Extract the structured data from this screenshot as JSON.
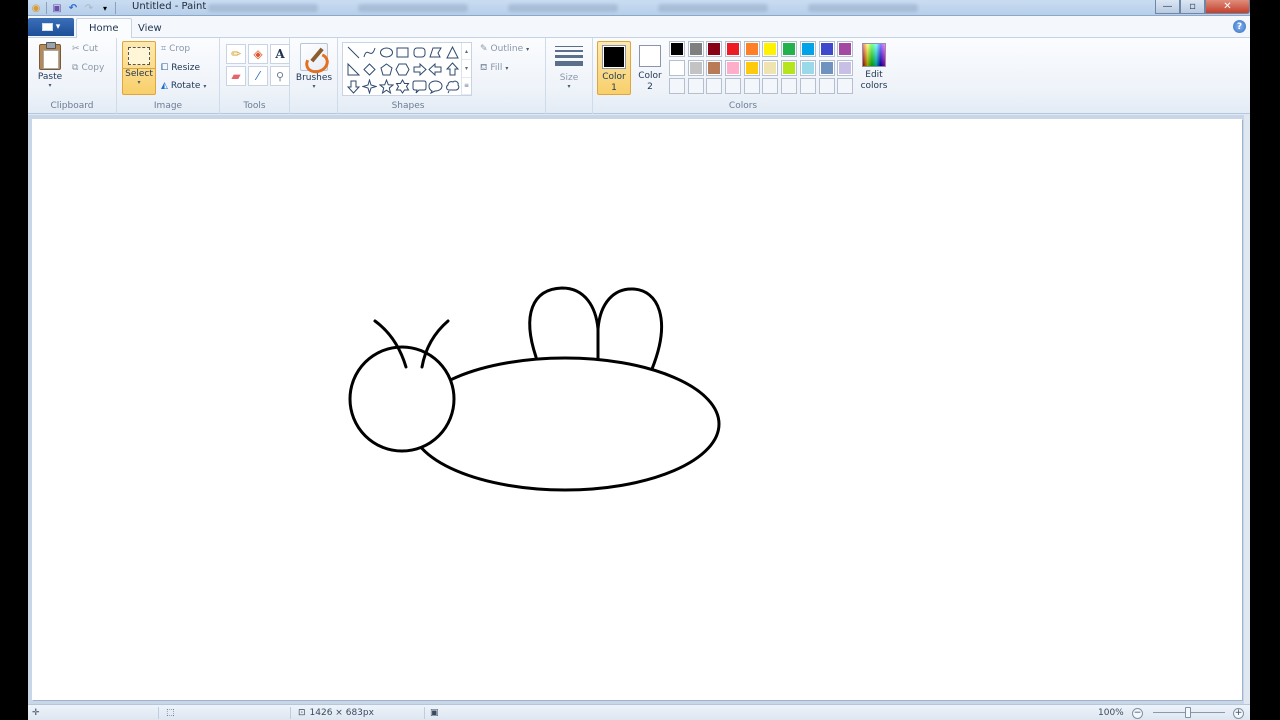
{
  "window": {
    "title": "Untitled - Paint",
    "quick_access": [
      {
        "icon": "paint-app-icon"
      },
      {
        "icon": "save-icon"
      },
      {
        "icon": "undo-icon"
      },
      {
        "icon": "redo-icon"
      },
      {
        "icon": "customize-qat-icon"
      }
    ],
    "controls": {
      "minimize": "—",
      "maximize": "▫",
      "close": "✕"
    }
  },
  "tabs": {
    "app_menu_caret": "▾",
    "items": [
      {
        "label": "Home",
        "active": true
      },
      {
        "label": "View",
        "active": false
      }
    ],
    "help": "?"
  },
  "ribbon": {
    "clipboard": {
      "label": "Clipboard",
      "paste": "Paste",
      "cut": "Cut",
      "copy": "Copy"
    },
    "image": {
      "label": "Image",
      "select": "Select",
      "crop": "Crop",
      "resize": "Resize",
      "rotate": "Rotate"
    },
    "tools": {
      "label": "Tools",
      "items": [
        {
          "name": "pencil-tool",
          "glyph": "✏"
        },
        {
          "name": "fill-tool",
          "glyph": "◈"
        },
        {
          "name": "text-tool",
          "glyph": "A"
        },
        {
          "name": "eraser-tool",
          "glyph": "▰"
        },
        {
          "name": "color-picker-tool",
          "glyph": "⁄"
        },
        {
          "name": "magnifier-tool",
          "glyph": "🔍"
        }
      ]
    },
    "brushes": {
      "label": "Brushes"
    },
    "shapes": {
      "label": "Shapes",
      "outline": "Outline",
      "fill": "Fill",
      "items": [
        "line",
        "curve",
        "oval",
        "rectangle",
        "rounded-rectangle",
        "polygon",
        "triangle",
        "right-triangle",
        "diamond",
        "pentagon",
        "hexagon",
        "right-arrow",
        "left-arrow",
        "up-arrow",
        "down-arrow",
        "four-point-star",
        "five-point-star",
        "six-point-star",
        "rounded-callout",
        "oval-callout",
        "cloud-callout"
      ]
    },
    "size": {
      "label": "Size"
    },
    "colors": {
      "label": "Colors",
      "color1": {
        "label_line1": "Color",
        "label_line2": "1",
        "value": "#000000"
      },
      "color2": {
        "label_line1": "Color",
        "label_line2": "2",
        "value": "#ffffff"
      },
      "palette": [
        "#000000",
        "#7f7f7f",
        "#880015",
        "#ed1c24",
        "#ff7f27",
        "#fff200",
        "#22b14c",
        "#00a2e8",
        "#3f48cc",
        "#a349a4",
        "#ffffff",
        "#c3c3c3",
        "#b97a57",
        "#ffaec9",
        "#ffc90e",
        "#efe4b0",
        "#b5e61d",
        "#99d9ea",
        "#7092be",
        "#c8bfe7",
        "",
        "",
        "",
        "",
        "",
        "",
        "",
        "",
        "",
        ""
      ],
      "edit_line1": "Edit",
      "edit_line2": "colors"
    }
  },
  "canvas": {
    "drawing": "fly doodle: oval body, round head, two antennae, two wings",
    "stroke_color": "#000000"
  },
  "statusbar": {
    "dimensions": "1426 × 683px",
    "zoom": "100%",
    "zoom_out": "−",
    "zoom_in": "+",
    "zoom_level": 1.0
  }
}
